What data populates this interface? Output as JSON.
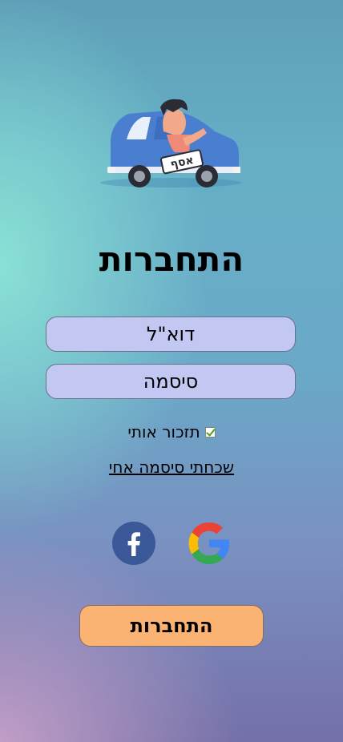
{
  "logo": {
    "plate_text": "אסף",
    "icon": "driving-car-logo"
  },
  "login": {
    "title": "התחברות",
    "email_placeholder": "דוא\"ל",
    "password_placeholder": "סיסמה",
    "remember_label": "תזכור אותי",
    "remember_checked": true,
    "forgot_link": "שכחתי סיסמה אחי",
    "submit_label": "התחברות"
  },
  "social": {
    "facebook_icon": "facebook-icon",
    "google_icon": "google-icon",
    "facebook_color": "#3b5998"
  },
  "colors": {
    "field_bg": "#c3c8f2",
    "submit_bg": "#fbb374"
  }
}
